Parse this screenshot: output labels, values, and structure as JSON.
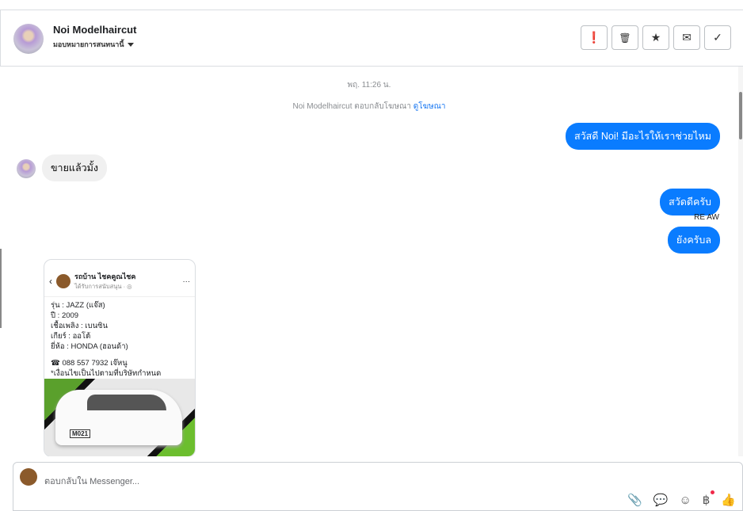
{
  "header": {
    "name": "Noi Modelhaircut",
    "assign_label": "มอบหมายการสนทนานี้",
    "actions": [
      {
        "icon": "alert-icon",
        "glyph": "❗"
      },
      {
        "icon": "trash-icon",
        "glyph": "🗑"
      },
      {
        "icon": "star-icon",
        "glyph": "★"
      },
      {
        "icon": "mail-icon",
        "glyph": "✉"
      },
      {
        "icon": "check-icon",
        "glyph": "✓"
      }
    ]
  },
  "chat": {
    "timestamp": "พฤ. 11:26 น.",
    "ad_reply_text": "Noi Modelhaircut ตอบกลับโฆษณา",
    "ad_link": "ดูโฆษณา",
    "messages": [
      {
        "dir": "out",
        "text": "สวัสดี Noi! มีอะไรให้เราช่วยไหม"
      },
      {
        "dir": "in",
        "text": "ขายแล้วมั้ง"
      },
      {
        "dir": "out",
        "text": "สวัดดีครับ"
      },
      {
        "dir": "out",
        "text": "ยังครับล"
      }
    ],
    "signature": "RE AW",
    "post": {
      "page_name": "รถบ้าน ไชคคูณไชค",
      "subtitle": "ได้รับการสนับสนุน · ◎",
      "lines": [
        "รุ่น : JAZZ (แจ๊ส)",
        "ปี : 2009",
        "เชื้อเพลิง : เบนซิน",
        "เกียร์ : ออโต้",
        "ยี่ห้อ : HONDA (ฮอนด้า)",
        "",
        "☎ 088 557 7932 เจ๊หนู",
        "*เงื่อนไขเป็นไปตามที่บริษัทกำหนด"
      ],
      "plate": "M021"
    }
  },
  "composer": {
    "placeholder": "ตอบกลับใน Messenger...",
    "tools": [
      "📎",
      "💬",
      "☺",
      "฿",
      "👍"
    ]
  }
}
